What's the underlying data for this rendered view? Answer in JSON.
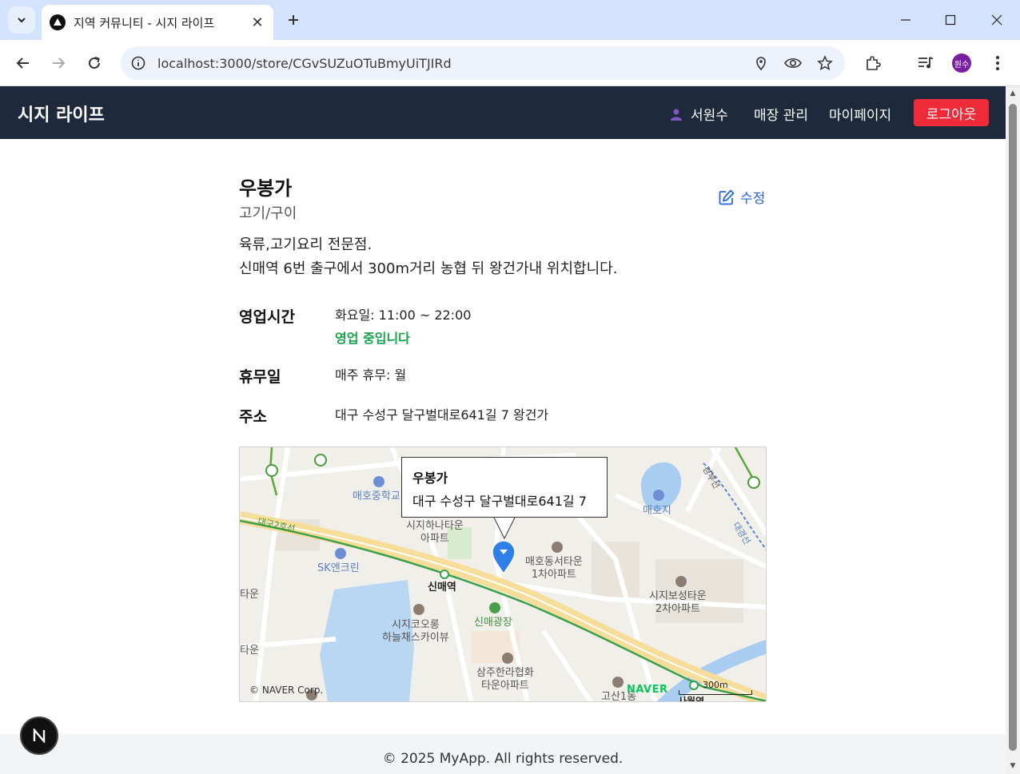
{
  "browser": {
    "tab_title": "지역 커뮤니티 - 시지 라이프",
    "url": "localhost:3000/store/CGvSUZuOTuBmyUiTJIRd",
    "profile_initials": "원수"
  },
  "header": {
    "brand": "시지 라이프",
    "user_name": "서원수",
    "nav": [
      "매장 관리",
      "마이페이지"
    ],
    "logout": "로그아웃"
  },
  "store": {
    "name": "우봉가",
    "category": "고기/구이",
    "edit_label": "수정",
    "description": [
      "육류,고기요리 전문점.",
      "신매역 6번 출구에서 300m거리 농협 뒤 왕건가내 위치합니다."
    ],
    "hours_label": "영업시간",
    "hours_value": "화요일: 11:00 ~ 22:00",
    "open_status": "영업 중입니다",
    "closed_label": "휴무일",
    "closed_value": "매주 휴무: 월",
    "address_label": "주소",
    "address_value": "대구 수성구 달구벌대로641길 7 왕건가"
  },
  "map": {
    "popup_name": "우봉가",
    "popup_address": "대구 수성구 달구벌대로641길 7",
    "labels": {
      "school": "매호중학교",
      "lake": "매호지",
      "line_name": "대구2호선",
      "rail_1": "경부선",
      "rail_2": "대경선",
      "apt_1a": "시지하나타운",
      "apt_1b": "아파트",
      "gas": "SK엔크린",
      "station_1": "신매역",
      "apt_2a": "매호동서타운",
      "apt_2b": "1차아파트",
      "apt_3a": "시지보성타운",
      "apt_3b": "2차아파트",
      "apt_4a": "시지코오롱",
      "apt_4b": "하늘채스카이뷰",
      "park": "신매광장",
      "apt_5a": "삼주한라협화",
      "apt_5b": "타운아파트",
      "edge_1": "타운",
      "edge_2": "타운",
      "dong": "고산1동",
      "station_2": "사월역"
    },
    "copyright": "© NAVER Corp.",
    "logo": "NAVER",
    "scale": "300m"
  },
  "footer": {
    "text": "© 2025 MyApp. All rights reserved."
  }
}
